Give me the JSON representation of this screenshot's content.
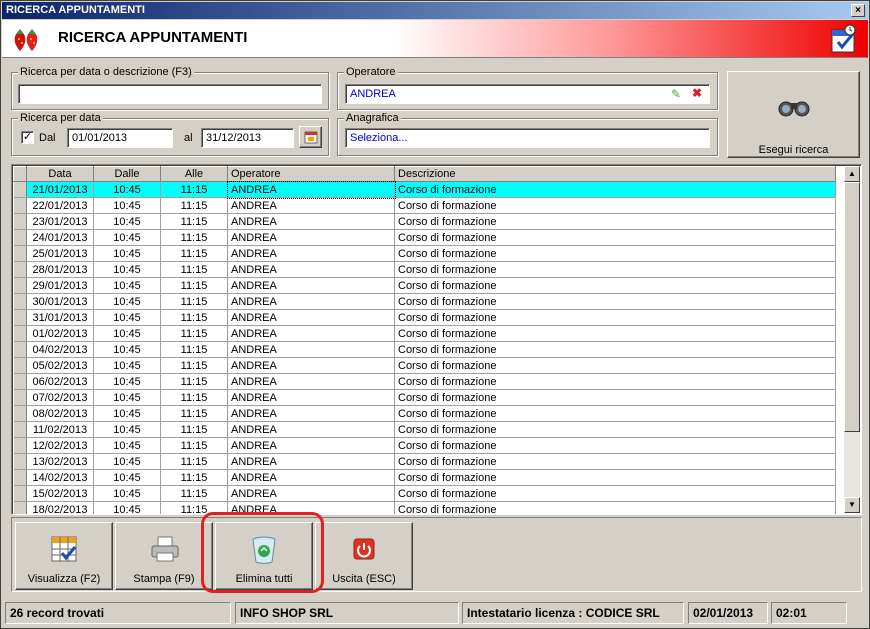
{
  "window": {
    "title": "RICERCA APPUNTAMENTI",
    "close_glyph": "×"
  },
  "header": {
    "title": "RICERCA APPUNTAMENTI",
    "logo_icon": "strawberry-logo-icon",
    "calendar_icon": "calendar-check-icon"
  },
  "search": {
    "desc_legend": "Ricerca per data o descrizione (F3)",
    "desc_value": "",
    "date_legend": "Ricerca per data",
    "dal_label": "Dal",
    "dal_checked": true,
    "date_from": "01/01/2013",
    "al_label": "al",
    "date_to": "31/12/2013",
    "operator_legend": "Operatore",
    "operator_value": "ANDREA",
    "anagrafica_legend": "Anagrafica",
    "anagrafica_value": "Seleziona...",
    "run_label": "Esegui ricerca"
  },
  "grid": {
    "columns": [
      "Data",
      "Dalle",
      "Alle",
      "Operatore",
      "Descrizione"
    ],
    "rows": [
      [
        "21/01/2013",
        "10:45",
        "11:15",
        "ANDREA",
        "Corso di formazione"
      ],
      [
        "22/01/2013",
        "10:45",
        "11:15",
        "ANDREA",
        "Corso di formazione"
      ],
      [
        "23/01/2013",
        "10:45",
        "11:15",
        "ANDREA",
        "Corso di formazione"
      ],
      [
        "24/01/2013",
        "10:45",
        "11:15",
        "ANDREA",
        "Corso di formazione"
      ],
      [
        "25/01/2013",
        "10:45",
        "11:15",
        "ANDREA",
        "Corso di formazione"
      ],
      [
        "28/01/2013",
        "10:45",
        "11:15",
        "ANDREA",
        "Corso di formazione"
      ],
      [
        "29/01/2013",
        "10:45",
        "11:15",
        "ANDREA",
        "Corso di formazione"
      ],
      [
        "30/01/2013",
        "10:45",
        "11:15",
        "ANDREA",
        "Corso di formazione"
      ],
      [
        "31/01/2013",
        "10:45",
        "11:15",
        "ANDREA",
        "Corso di formazione"
      ],
      [
        "01/02/2013",
        "10:45",
        "11:15",
        "ANDREA",
        "Corso di formazione"
      ],
      [
        "04/02/2013",
        "10:45",
        "11:15",
        "ANDREA",
        "Corso di formazione"
      ],
      [
        "05/02/2013",
        "10:45",
        "11:15",
        "ANDREA",
        "Corso di formazione"
      ],
      [
        "06/02/2013",
        "10:45",
        "11:15",
        "ANDREA",
        "Corso di formazione"
      ],
      [
        "07/02/2013",
        "10:45",
        "11:15",
        "ANDREA",
        "Corso di formazione"
      ],
      [
        "08/02/2013",
        "10:45",
        "11:15",
        "ANDREA",
        "Corso di formazione"
      ],
      [
        "11/02/2013",
        "10:45",
        "11:15",
        "ANDREA",
        "Corso di formazione"
      ],
      [
        "12/02/2013",
        "10:45",
        "11:15",
        "ANDREA",
        "Corso di formazione"
      ],
      [
        "13/02/2013",
        "10:45",
        "11:15",
        "ANDREA",
        "Corso di formazione"
      ],
      [
        "14/02/2013",
        "10:45",
        "11:15",
        "ANDREA",
        "Corso di formazione"
      ],
      [
        "15/02/2013",
        "10:45",
        "11:15",
        "ANDREA",
        "Corso di formazione"
      ],
      [
        "18/02/2013",
        "10:45",
        "11:15",
        "ANDREA",
        "Corso di formazione"
      ]
    ],
    "selected_row": 0
  },
  "toolbar": {
    "view_label": "Visualizza (F2)",
    "print_label": "Stampa (F9)",
    "delete_all_label": "Elimina tutti",
    "exit_label": "Uscita (ESC)"
  },
  "status": {
    "records": "26 record trovati",
    "company": "INFO SHOP SRL",
    "license": "Intestatario licenza : CODICE SRL",
    "date": "02/01/2013",
    "time": "02:01"
  },
  "colors": {
    "selection": "#00ffff",
    "highlight_ring": "#e02020"
  }
}
